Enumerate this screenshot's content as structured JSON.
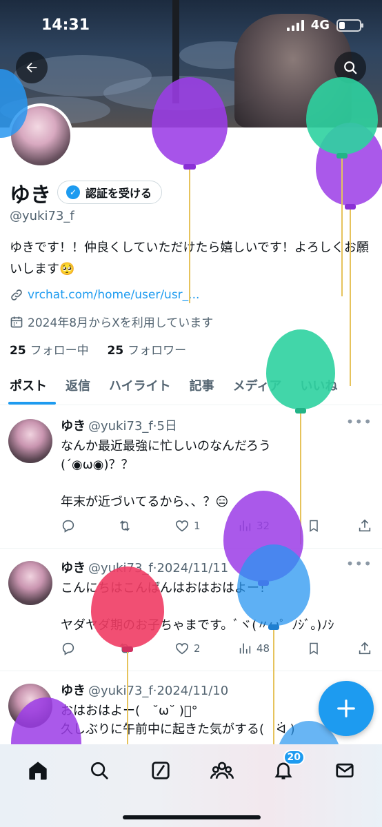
{
  "status": {
    "time": "14:31",
    "network": "4G"
  },
  "profile": {
    "name": "ゆき",
    "verify_label": "認証を受ける",
    "handle": "@yuki73_f",
    "bio": "ゆきです！！仲良くしていただけたら嬉しいです！よろしくお願いします🥺",
    "link": "vrchat.com/home/user/usr_...",
    "joined": "2024年8月からXを利用しています",
    "following_count": "25",
    "following_label": "フォロー中",
    "followers_count": "25",
    "followers_label": "フォロワー"
  },
  "tabs": [
    {
      "label": "ポスト",
      "active": true
    },
    {
      "label": "返信"
    },
    {
      "label": "ハイライト"
    },
    {
      "label": "記事"
    },
    {
      "label": "メディア"
    },
    {
      "label": "いいね"
    }
  ],
  "posts": [
    {
      "name": "ゆき",
      "meta": "@yuki73_f·5日",
      "text": "なんか最近最強に忙しいのなんだろう\n(´◉ω◉)？？\n\n年末が近づいてるから、、？😑",
      "replies": "",
      "reposts": "",
      "likes": "1",
      "views": "32"
    },
    {
      "name": "ゆき",
      "meta": "@yuki73_f·2024/11/11",
      "text": "こんにちはこんばんはおはおはよー！\n\nヤダヤダ期のお子ちゃまです。ﾞヾ(〃ω゜ﾉｼﾞ。)ﾉｼ",
      "replies": "",
      "reposts": "",
      "likes": "2",
      "views": "48"
    },
    {
      "name": "ゆき",
      "meta": "@yuki73_f·2024/11/10",
      "text": "おはおはよー(　˘ω˘ )ﾟ°\n久しぶりに午前中に起きた気がする(　ᐛ )",
      "replies": "",
      "reposts": "",
      "likes": "",
      "views": ""
    }
  ],
  "nav": {
    "notifications_badge": "20"
  },
  "icons": {
    "back": "back-arrow-icon",
    "search": "search-icon",
    "verified": "verified-badge-icon",
    "link": "link-icon",
    "calendar": "calendar-icon",
    "more": "more-dots-icon",
    "reply": "reply-icon",
    "repost": "repost-icon",
    "like": "heart-icon",
    "views": "views-chart-icon",
    "bookmark": "bookmark-icon",
    "share": "share-icon",
    "compose": "plus-icon",
    "home": "home-icon",
    "grok": "grok-icon",
    "communities": "communities-icon",
    "notifications": "bell-icon",
    "messages": "mail-icon"
  },
  "colors": {
    "accent": "#1d9bf0",
    "text": "#0f1419",
    "muted": "#536471"
  }
}
